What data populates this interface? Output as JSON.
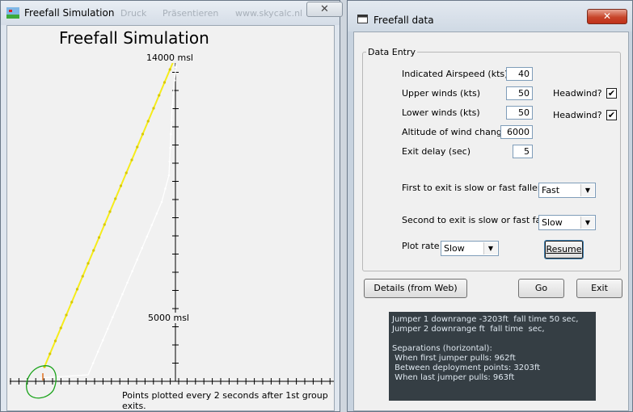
{
  "background_window": {
    "tab_fragments": [
      "Druck",
      "Präsentieren",
      "www.skycalc.nl"
    ]
  },
  "sim_window": {
    "title": "Freefall Simulation",
    "close_symbol": "✕",
    "plot_title": "Freefall Simulation",
    "alt_label_top": "14000 msl",
    "alt_label_mid": "5000 msl",
    "footer_note": "Points plotted every 2 seconds after 1st group exits."
  },
  "data_window": {
    "title": "Freefall data",
    "close_symbol": "✕",
    "fieldset_legend": "Data Entry",
    "fields": {
      "airspeed_label": "Indicated Airspeed (kts)",
      "airspeed_value": "40",
      "upper_winds_label": "Upper winds (kts)",
      "upper_winds_value": "50",
      "lower_winds_label": "Lower winds (kts)",
      "lower_winds_value": "50",
      "wind_change_label": "Altitude of wind change",
      "wind_change_value": "6000",
      "exit_delay_label": "Exit delay (sec)",
      "exit_delay_value": "5",
      "headwind1_label": "Headwind?",
      "headwind1_checked": "✔",
      "headwind2_label": "Headwind?",
      "headwind2_checked": "✔",
      "first_exit_label": "First to exit is slow or fast faller?",
      "first_exit_value": "Fast",
      "second_exit_label": "Second to exit is slow or fast faller?",
      "second_exit_value": "Slow",
      "plot_rate_label": "Plot rate",
      "plot_rate_value": "Slow",
      "dropdown_arrow": "▼"
    },
    "buttons": {
      "resume": "Resume",
      "details": "Details (from Web)",
      "go": "Go",
      "exit": "Exit"
    },
    "results": {
      "line1": "Jumper 1 downrange -3203ft  fall time 50 sec,",
      "line2": "Jumper 2 downrange ft  fall time  sec,",
      "line3": "Separations (horizontal):",
      "line4": " When first jumper pulls: 962ft",
      "line5": " Between deployment points: 3203ft",
      "line6": " When last jumper pulls: 963ft"
    }
  },
  "chart_data": {
    "type": "line",
    "title": "Freefall Simulation",
    "series": [
      {
        "color": "#f5ec1a",
        "style": "solid-with-dots"
      },
      {
        "color": "#ffffff",
        "style": "solid-with-dots"
      }
    ],
    "axis_labels": [
      "14000 msl",
      "5000 msl"
    ],
    "grid": false,
    "colors": {
      "jumper1": "#f5ec1a",
      "jumper2": "#ffffff",
      "aircraft": "#e02020",
      "annotation": "#1aa31a"
    }
  }
}
